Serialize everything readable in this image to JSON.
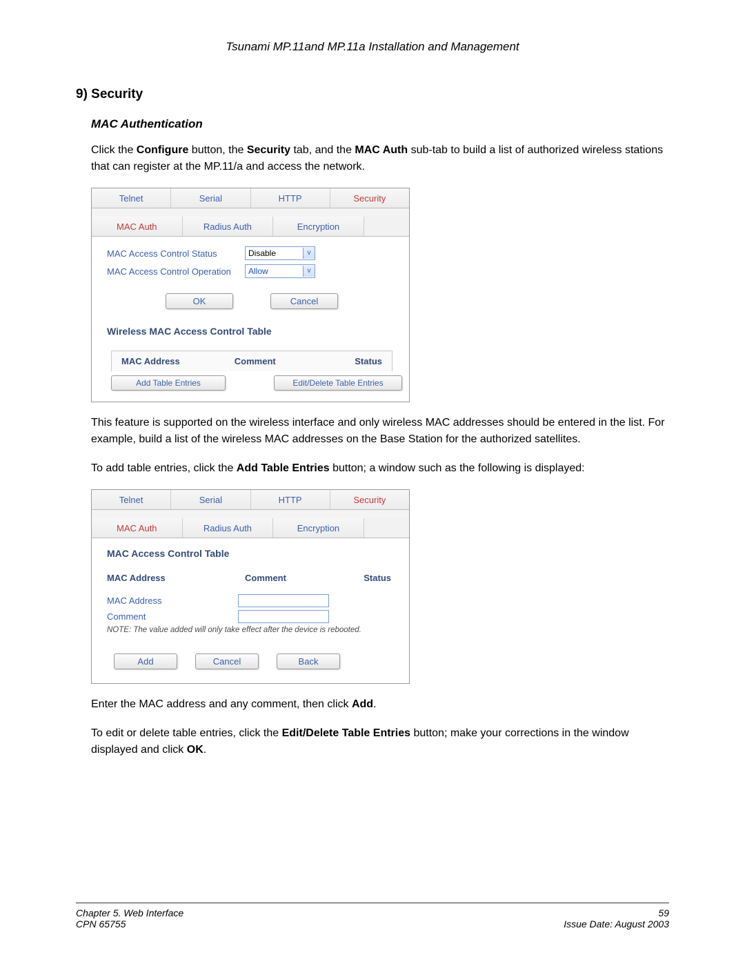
{
  "doc_title": "Tsunami MP.11and MP.11a Installation and Management",
  "section_heading": "9) Security",
  "sub_heading": "MAC Authentication",
  "para1_pre": "Click the ",
  "para1_b1": "Configure",
  "para1_mid1": " button, the ",
  "para1_b2": "Security",
  "para1_mid2": " tab, and the ",
  "para1_b3": "MAC Auth",
  "para1_post": " sub-tab to build a list of authorized wireless stations that can register at the MP.11/a and access the network.",
  "shot1": {
    "top_tabs": [
      "Telnet",
      "Serial",
      "HTTP",
      "Security"
    ],
    "top_active_index": 3,
    "sub_tabs": [
      "MAC Auth",
      "Radius Auth",
      "Encryption"
    ],
    "sub_active_index": 0,
    "row1_label": "MAC Access Control Status",
    "row1_value": "Disable",
    "row2_label": "MAC Access Control Operation",
    "row2_value": "Allow",
    "btn_ok": "OK",
    "btn_cancel": "Cancel",
    "panel_title": "Wireless MAC Access Control Table",
    "col1": "MAC Address",
    "col2": "Comment",
    "col3": "Status",
    "btn_add": "Add Table Entries",
    "btn_edit": "Edit/Delete Table Entries"
  },
  "para2": "This feature is supported on the wireless interface and only wireless MAC addresses should be entered in the list.  For example, build a list of the wireless MAC addresses on the Base Station for the authorized satellites.",
  "para3_pre": "To add table entries, click the ",
  "para3_b1": "Add Table Entries",
  "para3_post": " button; a window such as the following is displayed:",
  "shot2": {
    "top_tabs": [
      "Telnet",
      "Serial",
      "HTTP",
      "Security"
    ],
    "top_active_index": 3,
    "sub_tabs": [
      "MAC Auth",
      "Radius Auth",
      "Encryption"
    ],
    "sub_active_index": 0,
    "panel_title": "MAC Access Control Table",
    "col1": "MAC Address",
    "col2": "Comment",
    "col3": "Status",
    "row1_label": "MAC Address",
    "row2_label": "Comment",
    "note": "NOTE: The value added will only take effect after the device is rebooted.",
    "btn_add": "Add",
    "btn_cancel": "Cancel",
    "btn_back": "Back"
  },
  "para4_pre": "Enter the MAC address and any comment, then click ",
  "para4_b1": "Add",
  "para4_post": ".",
  "para5_pre": "To edit or delete table entries, click the ",
  "para5_b1": "Edit/Delete Table Entries",
  "para5_mid": " button; make your corrections in the window displayed and click ",
  "para5_b2": "OK",
  "para5_post": ".",
  "footer": {
    "chapter": "Chapter 5.  Web Interface",
    "cpn": "CPN 65755",
    "page": "59",
    "issue": "Issue Date:  August 2003"
  }
}
